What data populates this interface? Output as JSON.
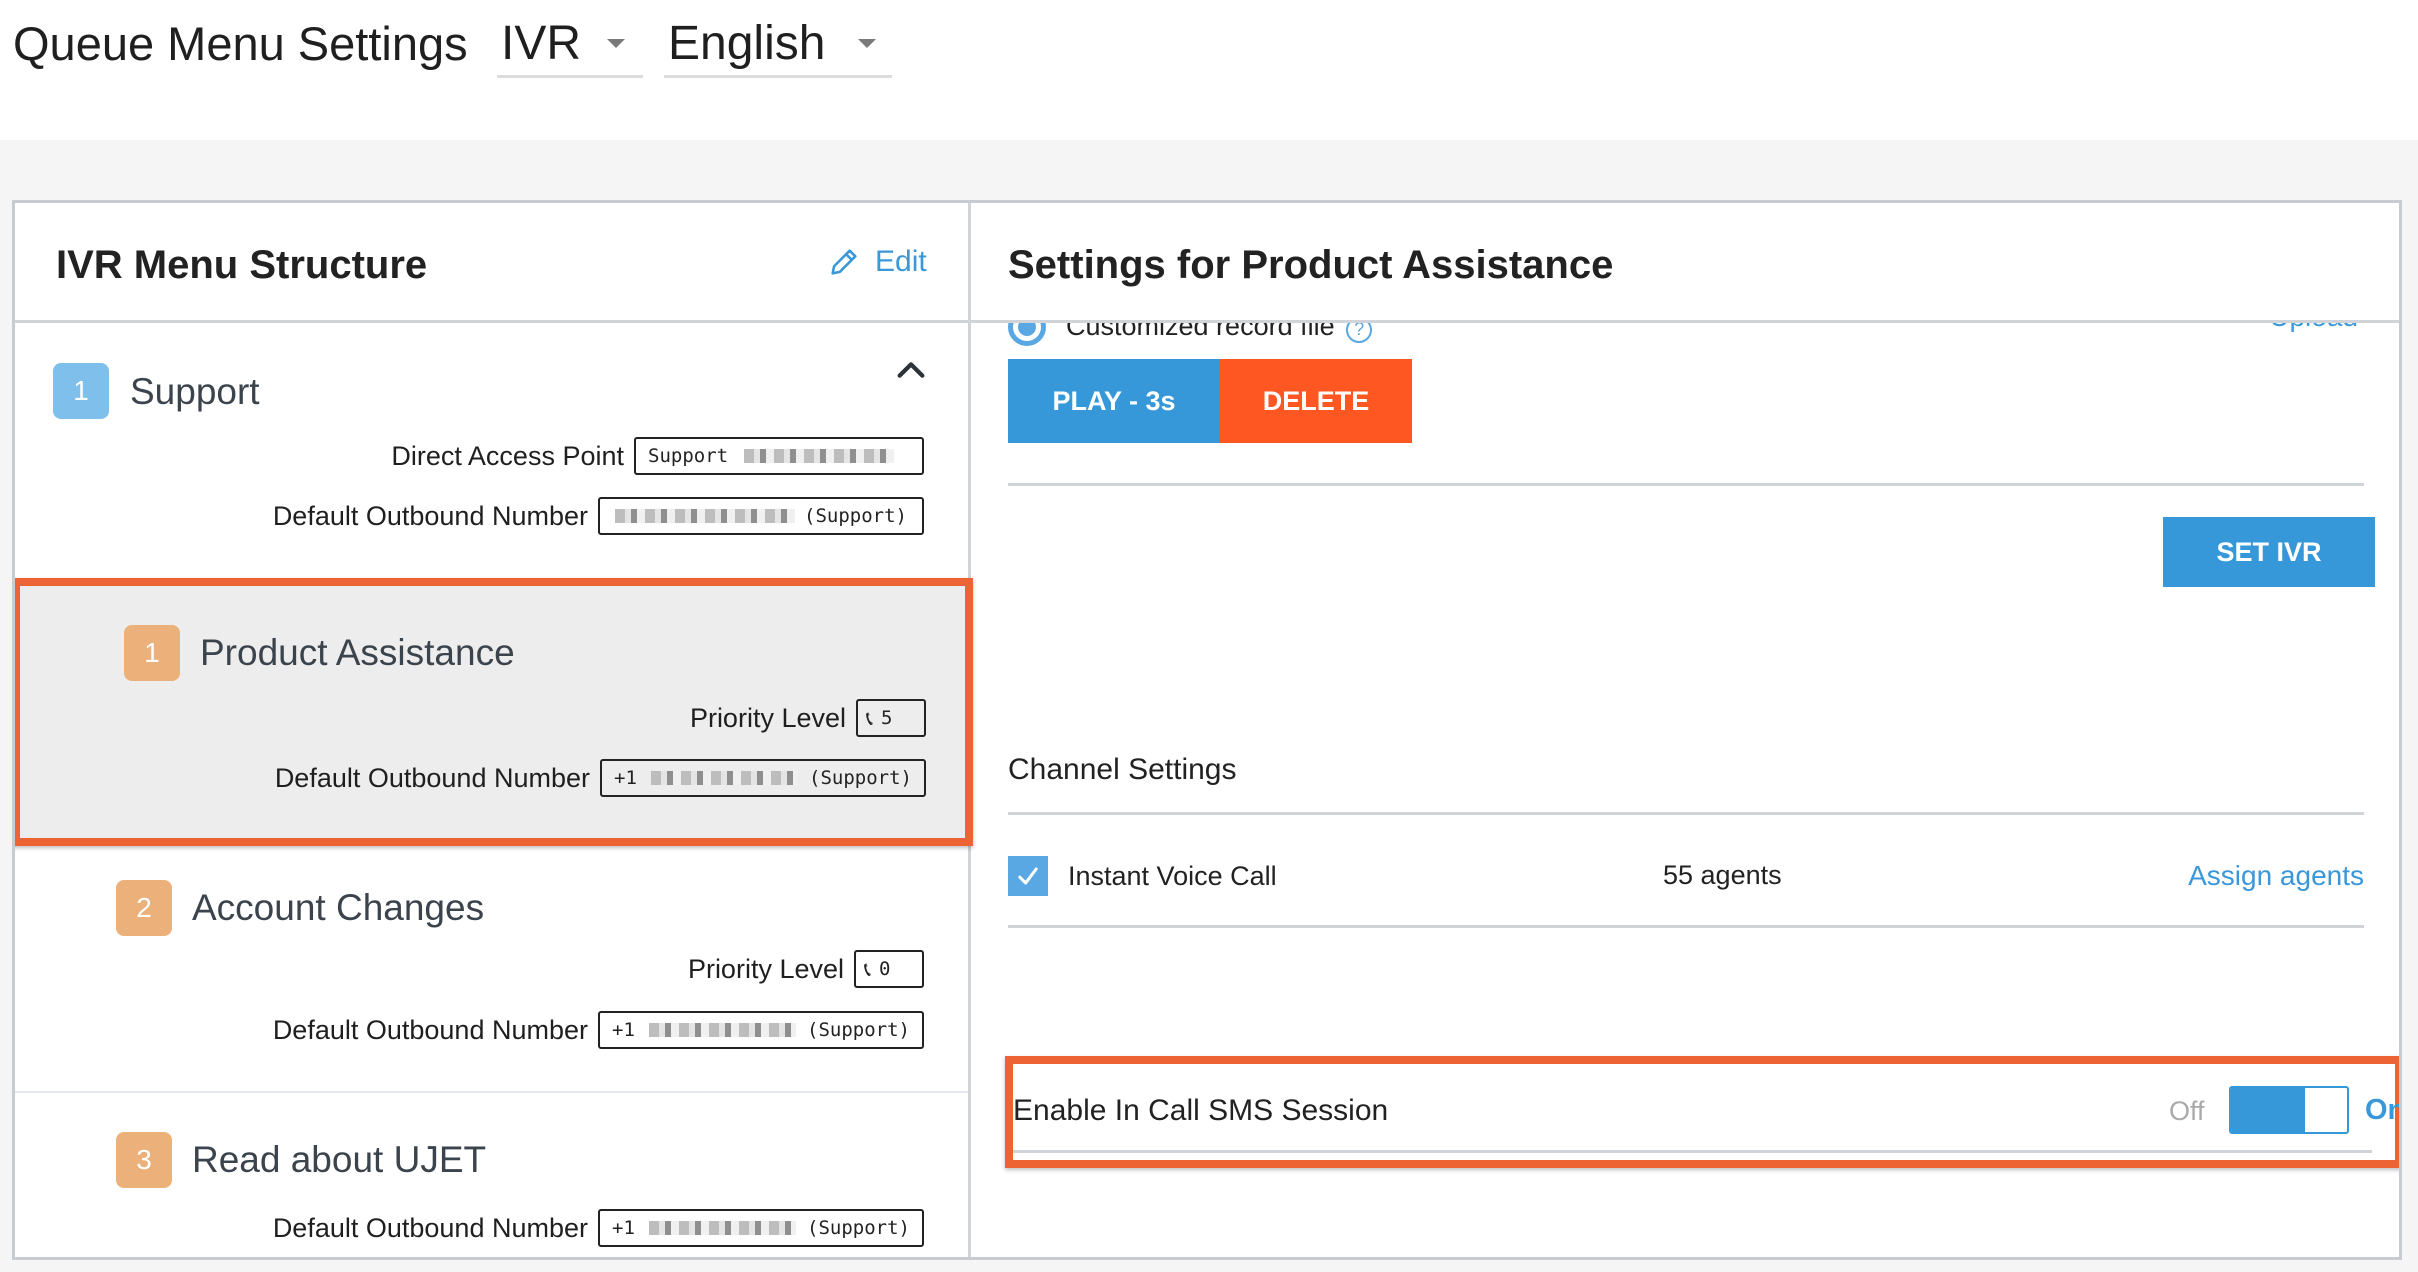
{
  "header": {
    "title": "Queue Menu Settings",
    "queue_type_select": {
      "value": "IVR"
    },
    "language_select": {
      "value": "English"
    }
  },
  "left_panel": {
    "title": "IVR Menu Structure",
    "edit_label": "Edit",
    "edit_icon": "pencil-icon",
    "items": [
      {
        "number": "1",
        "name": "Support",
        "badge_color": "#7fbfec",
        "expanded": true,
        "collapse_icon": "chevron-up-icon",
        "fields": [
          {
            "label": "Direct Access Point",
            "prefix": "Support",
            "suffix": ""
          },
          {
            "label": "Default Outbound Number",
            "prefix": "",
            "suffix": "(Support)"
          }
        ]
      },
      {
        "number": "1",
        "name": "Product Assistance",
        "badge_color": "#ecb07a",
        "selected": true,
        "fields": [
          {
            "label": "Priority Level",
            "icon": "phone-icon",
            "value": "5"
          },
          {
            "label": "Default Outbound Number",
            "prefix": "+1",
            "suffix": "(Support)"
          }
        ]
      },
      {
        "number": "2",
        "name": "Account Changes",
        "badge_color": "#ecb07a",
        "fields": [
          {
            "label": "Priority Level",
            "icon": "phone-icon",
            "value": "0"
          },
          {
            "label": "Default Outbound Number",
            "prefix": "+1",
            "suffix": "(Support)"
          }
        ]
      },
      {
        "number": "3",
        "name": "Read about UJET",
        "badge_color": "#ecb07a",
        "fields": [
          {
            "label": "Default Outbound Number",
            "prefix": "+1",
            "suffix": "(Support)"
          }
        ]
      }
    ]
  },
  "right_panel": {
    "title": "Settings for Product Assistance",
    "record_option": {
      "label": "Customized record file",
      "selected": true,
      "help_icon": "question-circle-icon"
    },
    "upload_label": "Upload",
    "play_button": "PLAY - 3s",
    "delete_button": "DELETE",
    "set_ivr_button": "SET IVR",
    "channel_settings": {
      "title": "Channel Settings",
      "channels": [
        {
          "label": "Instant Voice Call",
          "checked": true,
          "agents": "55 agents",
          "action": "Assign agents"
        }
      ]
    },
    "sms_session": {
      "label": "Enable In Call SMS Session",
      "off_label": "Off",
      "on_label": "On",
      "enabled": true,
      "toggle_fill_fraction": 0.64
    }
  },
  "colors": {
    "accent_blue": "#3698d9",
    "link_blue": "#3a97d9",
    "delete_orange": "#ff5722",
    "highlight_orange": "#ee6333",
    "badge_orange": "#ecb07a",
    "badge_blue": "#7fbfec"
  }
}
